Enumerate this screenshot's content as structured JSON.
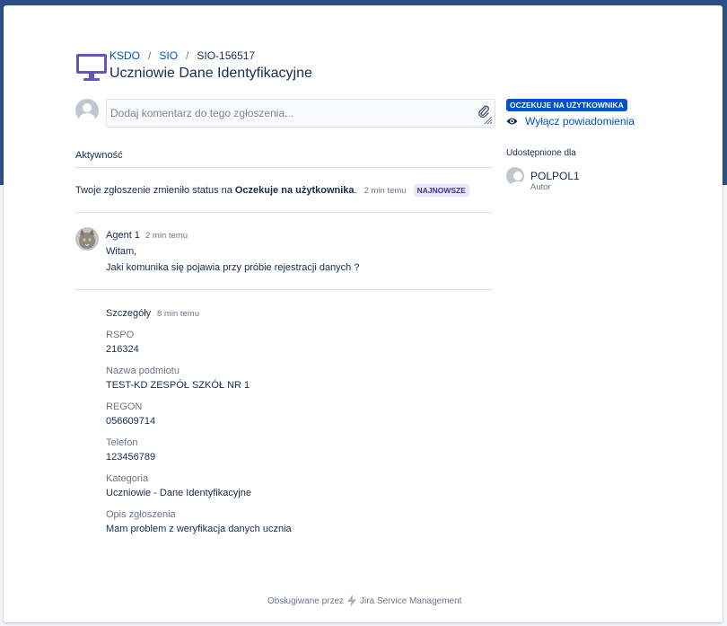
{
  "colors": {
    "band": "#2b4f86",
    "link": "#0052cc",
    "status_bg": "#0052cc",
    "new_badge_bg": "#eae6ff"
  },
  "breadcrumb": {
    "items": [
      "KSDO",
      "SIO"
    ],
    "separator": "/",
    "current": "SIO-156517"
  },
  "page": {
    "title": "Uczniowie Dane Identyfikacyjne"
  },
  "comment": {
    "placeholder": "Dodaj komentarz do tego zgłoszenia...",
    "value": ""
  },
  "activity": {
    "label": "Aktywność",
    "status_change": {
      "text": "Twoje zgłoszenie zmieniło status na",
      "status": "Oczekuje na użytkownika",
      "suffix": ".",
      "time": "2 min temu",
      "badge": "NAJNOWSZE"
    },
    "message": {
      "author": "Agent 1",
      "time": "2 min temu",
      "line1": "Witam,",
      "line2": "Jaki komunika się pojawia przy próbie rejestracji danych ?"
    },
    "details": {
      "title": "Szczegóły",
      "time": "8 min temu",
      "fields": [
        {
          "label": "RSPO",
          "value": "216324"
        },
        {
          "label": "Nazwa podmiotu",
          "value": "TEST-KD ZESPÓŁ SZKÓŁ NR 1"
        },
        {
          "label": "REGON",
          "value": "056609714"
        },
        {
          "label": "Telefon",
          "value": "123456789"
        },
        {
          "label": "Kategoria",
          "value": "Uczniowie - Dane Identyfikacyjne"
        },
        {
          "label": "Opis zgłoszenia",
          "value": "Mam problem z weryfikacja danych ucznia"
        }
      ]
    }
  },
  "sidebar": {
    "status": "OCZEKUJE NA UŻYTKOWNIKA",
    "notifications_link": "Wyłącz powiadomienia",
    "shared_label": "Udostępnione dla",
    "user": {
      "name": "POLPOL1",
      "role": "Autor"
    }
  },
  "footer": {
    "powered_by": "Obsługiwane przez",
    "product": "Jira Service Management"
  },
  "icons": [
    "project-monitor-icon",
    "user-avatar-icon",
    "attachment-icon",
    "resize-handle-icon",
    "agent-avatar-icon",
    "eye-icon",
    "bolt-icon"
  ]
}
